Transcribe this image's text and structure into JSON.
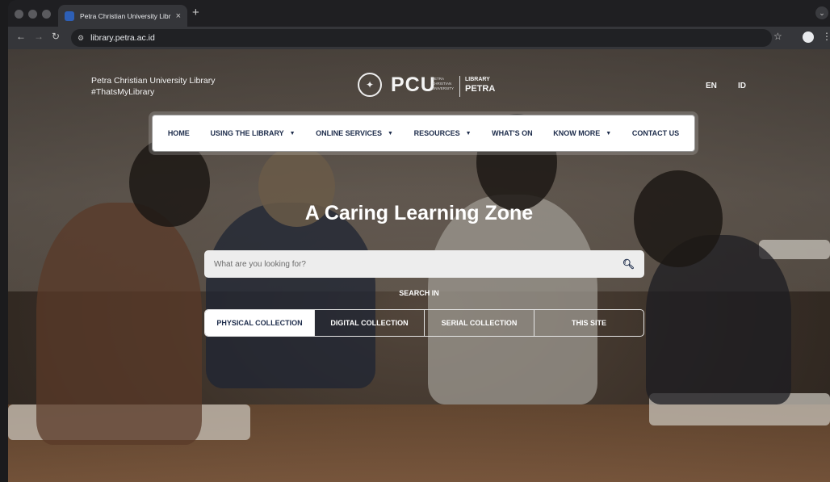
{
  "browser": {
    "tab_title": "Petra Christian University Libr",
    "tab_close": "×",
    "new_tab": "+",
    "url": "library.petra.ac.id"
  },
  "header": {
    "brand_line1": "Petra Christian University Library",
    "brand_line2": "#ThatsMyLibrary",
    "logo_text": "PCU",
    "logo_sub": "PETRA CHRISTIAN UNIVERSITY",
    "logo_library": "LIBRARY",
    "logo_petra": "PETRA",
    "lang_en": "EN",
    "lang_id": "ID"
  },
  "nav": {
    "items": [
      {
        "label": "HOME",
        "dropdown": false
      },
      {
        "label": "USING THE LIBRARY",
        "dropdown": true
      },
      {
        "label": "ONLINE SERVICES",
        "dropdown": true
      },
      {
        "label": "RESOURCES",
        "dropdown": true
      },
      {
        "label": "WHAT'S ON",
        "dropdown": false
      },
      {
        "label": "KNOW MORE",
        "dropdown": true
      },
      {
        "label": "CONTACT US",
        "dropdown": false
      }
    ]
  },
  "hero": {
    "title": "A Caring Learning Zone",
    "search_placeholder": "What are you looking for?",
    "search_in": "SEARCH IN",
    "options": [
      "PHYSICAL COLLECTION",
      "DIGITAL COLLECTION",
      "SERIAL COLLECTION",
      "THIS SITE"
    ],
    "selected_option": "PHYSICAL COLLECTION"
  }
}
